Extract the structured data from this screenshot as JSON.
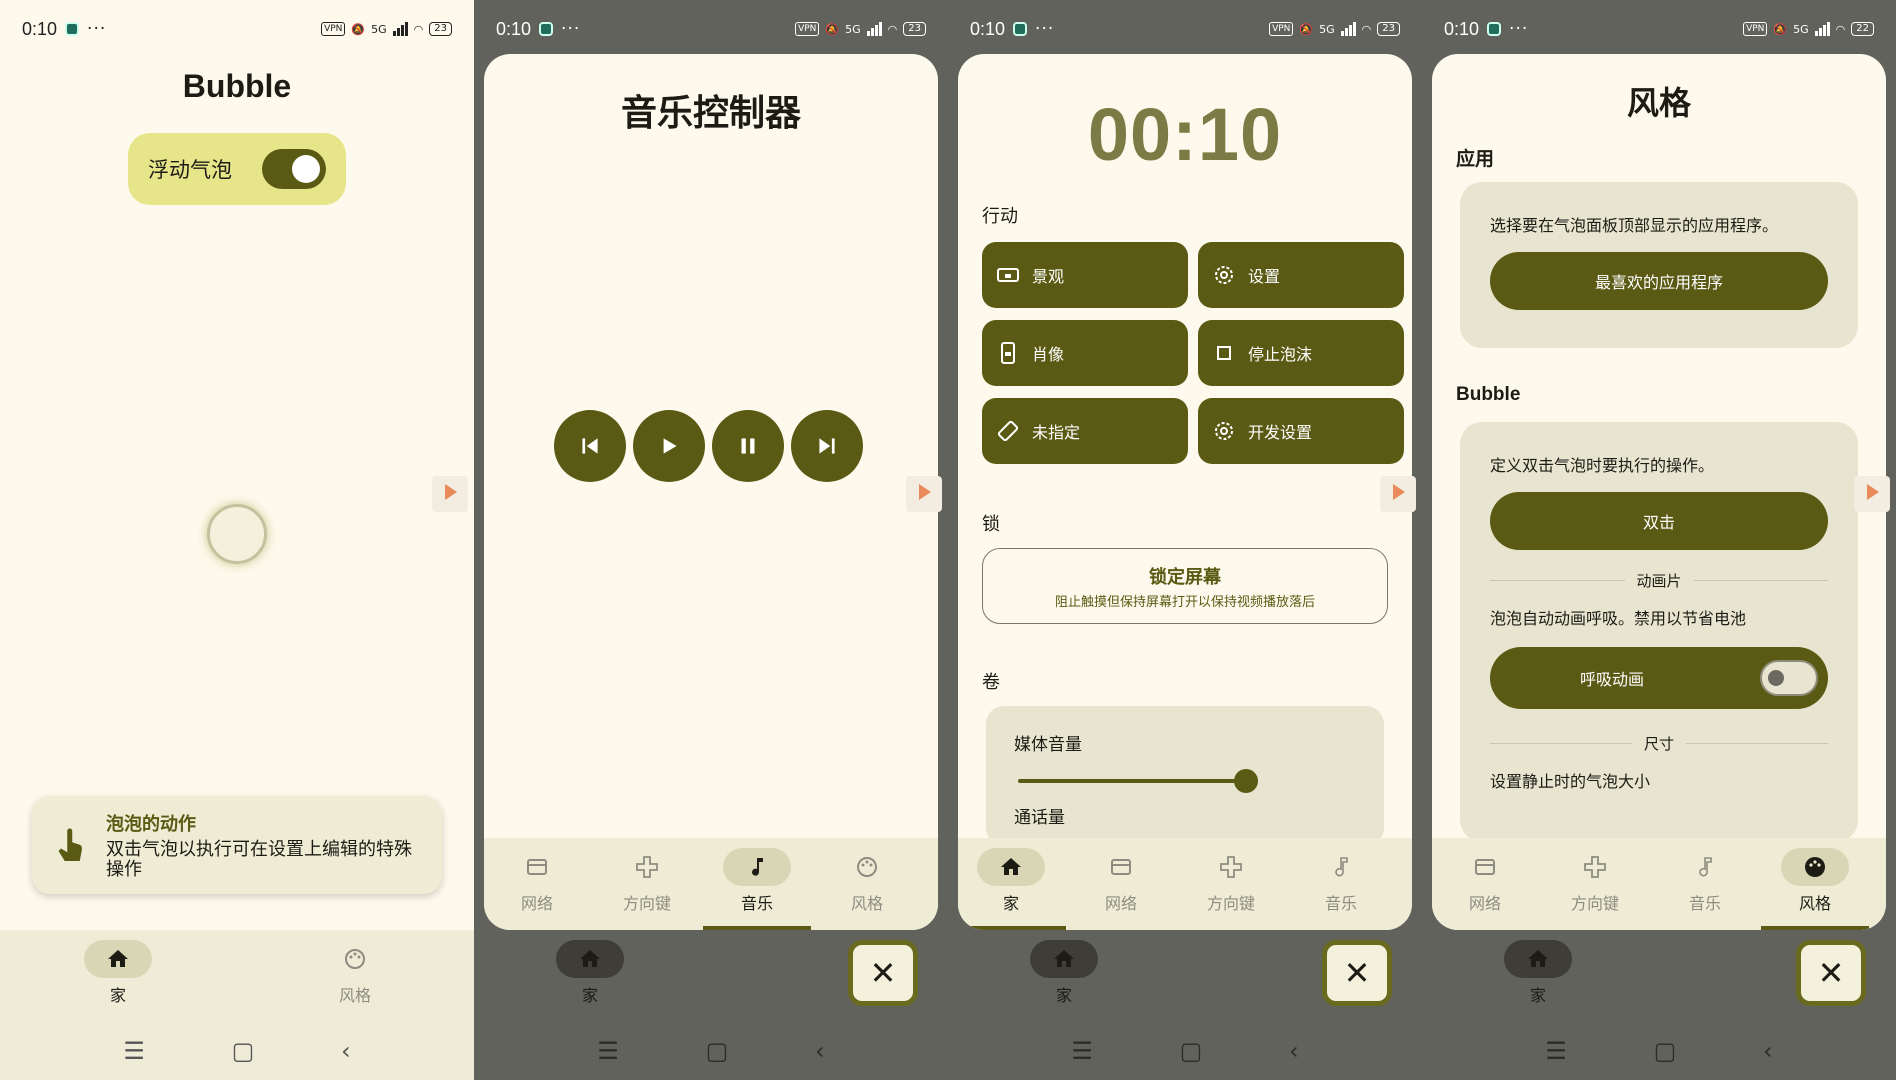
{
  "status": {
    "time": "0:10",
    "more": "···",
    "vpn": "VPN",
    "signal": "5G",
    "battery1": "23",
    "battery4": "22"
  },
  "screen1": {
    "title": "Bubble",
    "toggle_label": "浮动气泡",
    "tip_title": "泡泡的动作",
    "tip_body": "双击气泡以执行可在设置上编辑的特殊操作",
    "nav": [
      {
        "label": "家",
        "icon": "home-icon",
        "active": true
      },
      {
        "label": "风格",
        "icon": "palette-icon",
        "active": false
      }
    ]
  },
  "screen2": {
    "title": "音乐控制器",
    "controls": [
      "previous",
      "play",
      "pause",
      "next"
    ],
    "nav": [
      {
        "label": "网络"
      },
      {
        "label": "方向键"
      },
      {
        "label": "音乐"
      },
      {
        "label": "风格"
      }
    ]
  },
  "screen3": {
    "clock": "00:10",
    "actions_header": "行动",
    "actions": [
      {
        "label": "景观",
        "icon": "landscape-lock-icon"
      },
      {
        "label": "设置",
        "icon": "gear-icon"
      },
      {
        "label": "肖像",
        "icon": "portrait-lock-icon"
      },
      {
        "label": "停止泡沫",
        "icon": "square-icon"
      },
      {
        "label": "未指定",
        "icon": "rotate-icon"
      },
      {
        "label": "开发设置",
        "icon": "gear-icon"
      }
    ],
    "lock_header": "锁",
    "lock_title": "锁定屏幕",
    "lock_sub": "阻止触摸但保持屏幕打开以保持视频播放落后",
    "volume_header": "卷",
    "media_volume": "媒体音量",
    "media_volume_level": 0.95,
    "call_volume": "通话量",
    "nav": [
      {
        "label": "家"
      },
      {
        "label": "网络"
      },
      {
        "label": "方向键"
      },
      {
        "label": "音乐"
      }
    ]
  },
  "screen4": {
    "title": "风格",
    "apps_header": "应用",
    "apps_desc": "选择要在气泡面板顶部显示的应用程序。",
    "apps_button": "最喜欢的应用程序",
    "bubble_header": "Bubble",
    "bubble_desc": "定义双击气泡时要执行的操作。",
    "double_tap_button": "双击",
    "animation_divider": "动画片",
    "animation_desc": "泡泡自动动画呼吸。禁用以节省电池",
    "breath_label": "呼吸动画",
    "size_divider": "尺寸",
    "size_desc": "设置静止时的气泡大小",
    "nav": [
      {
        "label": "网络"
      },
      {
        "label": "方向键"
      },
      {
        "label": "音乐"
      },
      {
        "label": "风格"
      }
    ]
  },
  "under": {
    "home": "家",
    "style_partial": "风格"
  },
  "colors": {
    "primary": "#5a5a14",
    "surface": "#fdf9ec",
    "accent_pill": "#e7e58a"
  }
}
